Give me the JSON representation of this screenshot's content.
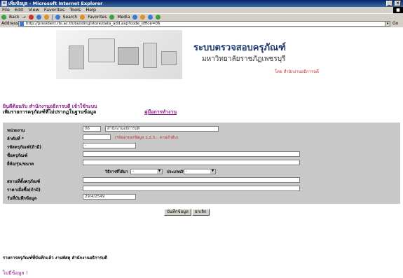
{
  "window": {
    "title": "เพิ่มข้อมูล - Microsoft Internet Explorer",
    "app_icon": "e",
    "minimize": "_",
    "close": "×"
  },
  "menubar": {
    "items": [
      "File",
      "Edit",
      "View",
      "Favorites",
      "Tools",
      "Help"
    ]
  },
  "toolbar": {
    "back": "Back",
    "forward": "→",
    "search": "Search",
    "favorites": "Favorites",
    "media": "Media"
  },
  "address": {
    "label": "Address",
    "url": "http://president.rbi.ac.th/building/store/data_add.asp?code_office=06",
    "dropdown": "▾",
    "go": "Go"
  },
  "banner": {
    "title": "ระบบตรวจสอบครุภัณฑ์",
    "university": "มหาวิทยาลัยราชภัฏเพชรบุรี",
    "by": "โดย สำนักงานอธิการบดี"
  },
  "page": {
    "welcome": "ยินดีต้อนรับ สำนักงานอธิการบดี เข้าใช้ระบบ",
    "subhead": "เพิ่มรายการครุภัณฑ์ที่ไม่ปรากฏในฐานข้อมูล",
    "manual_link": "คู่มือการทำงาน"
  },
  "form": {
    "labels": {
      "unit": "หน่วยงาน",
      "order": "ลำดับที่ *",
      "code": "รหัสครุภัณฑ์(ถ้ามี)",
      "name": "ชื่อครุภัณฑ์",
      "brand": "ยี่ห้อ/รุ่น/ขนาด",
      "acquire": "วิธีการที่ได้มา",
      "type": "ประเภทเงิน",
      "location": "สถานที่ตั้งครุภัณฑ์",
      "price": "ราคาเมื่อซื้อ(ถ้ามี)",
      "date": "วันที่บันทึกข้อมูล"
    },
    "values": {
      "unit_code": "06",
      "unit_name": "สำนักงานอธิการบดี",
      "order": "",
      "code": "-",
      "name": "",
      "brand": "",
      "acquire": "-",
      "type": "-",
      "location": "",
      "price": "",
      "date": "29/4/2549"
    },
    "hint": "(*ต้องกรอกข้อมูล 1,2,3... ตามลำดับ)",
    "save_button": "บันทึกข้อมูล",
    "cancel_button": "ยกเลิก"
  },
  "footer": {
    "list_title": "รายการครุภัณฑ์ที่บันทึกแล้ว งานพัสดุ สำนักงานอธิการบดี",
    "no_data": "ไม่มีข้อมูล !"
  }
}
